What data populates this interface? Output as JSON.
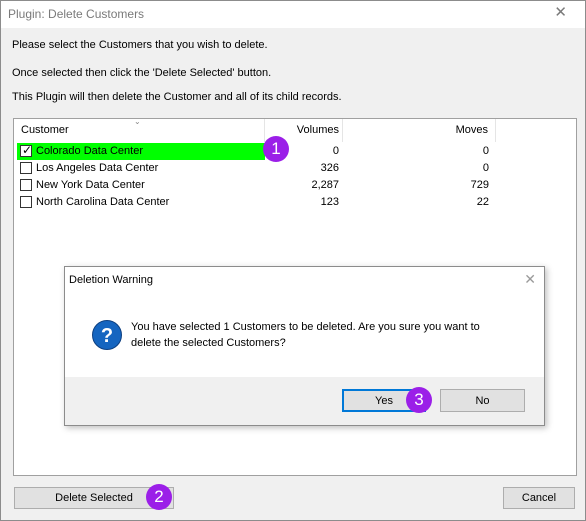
{
  "window": {
    "title": "Plugin: Delete Customers",
    "close_glyph": "✕"
  },
  "instructions": [
    "Please select the Customers that you wish to delete.",
    "Once selected then click the 'Delete Selected' button.",
    "This Plugin will then delete the Customer and all of its child records."
  ],
  "table": {
    "columns": [
      "Customer",
      "Volumes",
      "Moves"
    ],
    "sort_glyph": "⌄",
    "rows": [
      {
        "checked": true,
        "customer": "Colorado Data Center",
        "volumes": "0",
        "moves": "0"
      },
      {
        "checked": false,
        "customer": "Los Angeles Data Center",
        "volumes": "326",
        "moves": "0"
      },
      {
        "checked": false,
        "customer": "New York Data Center",
        "volumes": "2,287",
        "moves": "729"
      },
      {
        "checked": false,
        "customer": "North Carolina Data Center",
        "volumes": "123",
        "moves": "22"
      }
    ]
  },
  "check_mark": "✓",
  "buttons": {
    "delete_selected": "Delete Selected",
    "cancel": "Cancel"
  },
  "dialog": {
    "title": "Deletion Warning",
    "close_glyph": "✕",
    "icon_glyph": "?",
    "message_line1": "You have selected 1 Customers to be deleted. Are you sure you want to",
    "message_line2": "delete the selected Customers?",
    "yes": "Yes",
    "no": "No"
  },
  "markers": [
    "1",
    "2",
    "3"
  ],
  "colors": {
    "selected_row": "#00ff00",
    "marker": "#9b1fe8",
    "question_icon": "#1565c0",
    "focus_border": "#0078d7"
  }
}
